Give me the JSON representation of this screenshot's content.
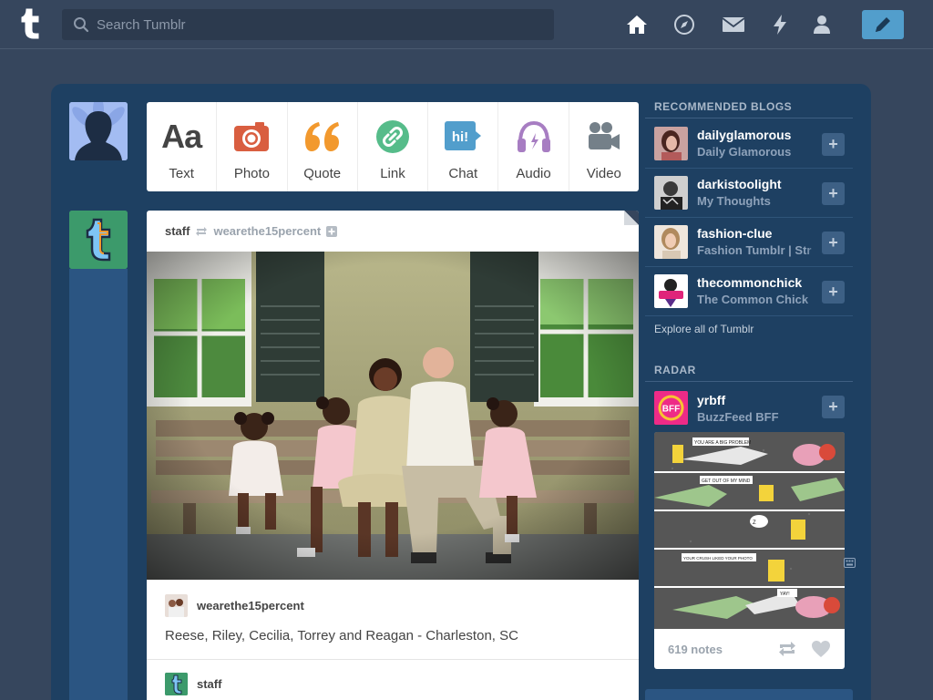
{
  "search": {
    "placeholder": "Search Tumblr"
  },
  "nav": {
    "icons": [
      "home-icon",
      "explore-icon",
      "inbox-icon",
      "activity-icon",
      "account-icon",
      "compose-icon"
    ],
    "accent": "#529ecc"
  },
  "post_types": [
    {
      "label": "Text",
      "icon": "text-icon",
      "color": "#444444"
    },
    {
      "label": "Photo",
      "icon": "camera-icon",
      "color": "#d95e40"
    },
    {
      "label": "Quote",
      "icon": "quote-icon",
      "color": "#f2992e"
    },
    {
      "label": "Link",
      "icon": "link-icon",
      "color": "#56bc8a"
    },
    {
      "label": "Chat",
      "icon": "chat-icon",
      "color": "#529ecc"
    },
    {
      "label": "Audio",
      "icon": "headphones-icon",
      "color": "#a77dc2"
    },
    {
      "label": "Video",
      "icon": "video-camera-icon",
      "color": "#748089"
    }
  ],
  "post": {
    "owner": "staff",
    "source": "wearethe15percent",
    "caption_user": "wearethe15percent",
    "caption": "Reese, Riley, Cecilia, Torrey and Reagan - Charleston, SC",
    "reblogger": "staff"
  },
  "sidebar": {
    "recommended_heading": "RECOMMENDED BLOGS",
    "recommended": [
      {
        "name": "dailyglamorous",
        "title": "Daily Glamorous"
      },
      {
        "name": "darkistoolight",
        "title": "My Thoughts"
      },
      {
        "name": "fashion-clue",
        "title": "Fashion Tumblr | Str"
      },
      {
        "name": "thecommonchick",
        "title": "The Common Chick"
      }
    ],
    "explore_label": "Explore all of Tumblr",
    "radar_heading": "RADAR",
    "radar": {
      "name": "yrbff",
      "title": "BuzzFeed BFF",
      "avatar_text": "BFF",
      "notes": "619 notes",
      "comic_lines": [
        "YOU ARE A BIG PROBLEM",
        "GET OUT OF MY MIND",
        "Z",
        "YOUR CRUSH LIKED YOUR PHOTO",
        "YAY!"
      ]
    },
    "follow_symbol": "+",
    "chat_badge": "hi!",
    "text_badge": "Aa"
  }
}
